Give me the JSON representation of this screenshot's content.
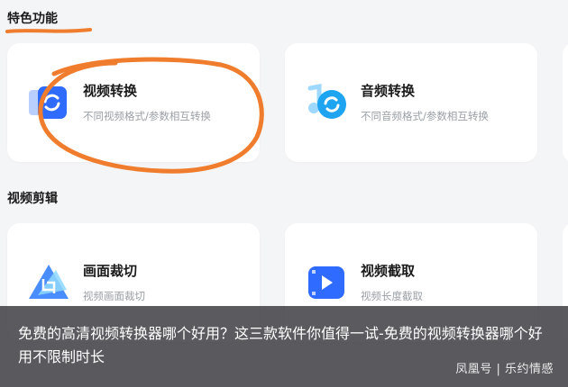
{
  "sections": {
    "featured": "特色功能",
    "video_edit": "视频剪辑"
  },
  "featured_cards": [
    {
      "title": "视频转换",
      "desc": "不同视频格式/参数相互转换",
      "icon": "video-convert-icon"
    },
    {
      "title": "音频转换",
      "desc": "不同音频格式/参数相互转换",
      "icon": "audio-convert-icon"
    }
  ],
  "edit_cards": [
    {
      "title": "画面裁切",
      "desc": "视频画面裁切",
      "icon": "crop-icon"
    },
    {
      "title": "视频截取",
      "desc": "视频长度截取",
      "icon": "video-trim-icon"
    }
  ],
  "article": {
    "caption": "免费的高清视频转换器哪个好用？这三款软件你值得一试-免费的视频转换器哪个好用不限制时长",
    "watermark": "凤凰号 | 乐约情感"
  },
  "colors": {
    "accent_blue": "#2f6bff",
    "annotation_orange": "#ef7d2d"
  }
}
